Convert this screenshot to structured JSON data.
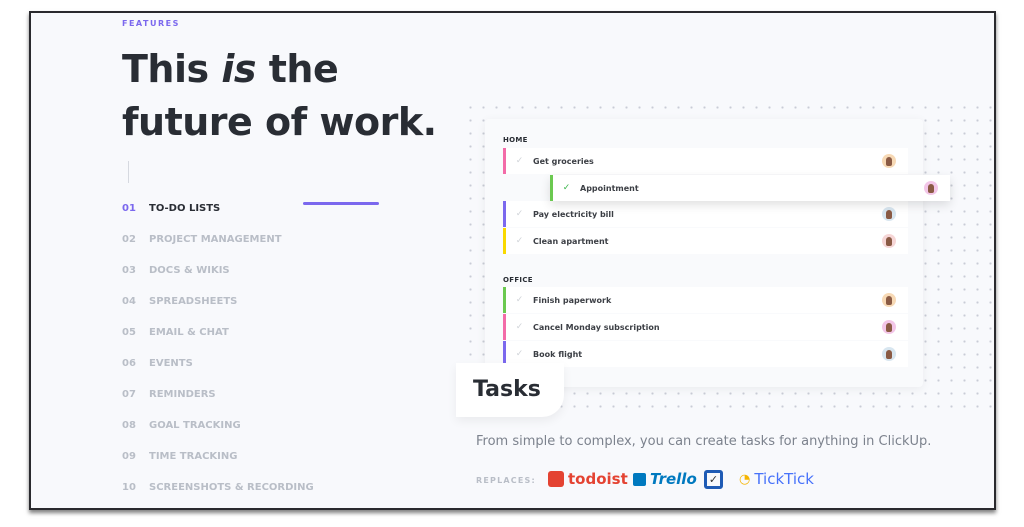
{
  "eyebrow": "FEATURES",
  "headline": {
    "line1_a": "This ",
    "line1_em": "is",
    "line1_b": " the",
    "line2": "future of work."
  },
  "nav": [
    {
      "num": "01",
      "label": "TO-DO LISTS",
      "active": true
    },
    {
      "num": "02",
      "label": "PROJECT MANAGEMENT"
    },
    {
      "num": "03",
      "label": "DOCS & WIKIS"
    },
    {
      "num": "04",
      "label": "SPREADSHEETS"
    },
    {
      "num": "05",
      "label": "EMAIL & CHAT"
    },
    {
      "num": "06",
      "label": "EVENTS"
    },
    {
      "num": "07",
      "label": "REMINDERS"
    },
    {
      "num": "08",
      "label": "GOAL TRACKING"
    },
    {
      "num": "09",
      "label": "TIME TRACKING"
    },
    {
      "num": "10",
      "label": "SCREENSHOTS & RECORDING"
    }
  ],
  "groups": {
    "home": {
      "label": "HOME",
      "tasks": [
        {
          "name": "Get groceries",
          "color": "#f36ba8"
        },
        {
          "name": "Appointment",
          "color": "#6bc950",
          "done": true
        },
        {
          "name": "Pay electricity bill",
          "color": "#7b68ee"
        },
        {
          "name": "Clean apartment",
          "color": "#f9d900"
        }
      ]
    },
    "office": {
      "label": "OFFICE",
      "tasks": [
        {
          "name": "Finish paperwork",
          "color": "#6bc950"
        },
        {
          "name": "Cancel Monday subscription",
          "color": "#f36ba8"
        },
        {
          "name": "Book flight",
          "color": "#7b68ee"
        }
      ]
    }
  },
  "tab_label": "Tasks",
  "description": "From simple to complex, you can create tasks for anything in ClickUp.",
  "replaces": {
    "label": "REPLACES:",
    "logos": [
      "todoist",
      "Trello",
      "TickTick"
    ]
  },
  "colors": {
    "accent": "#7b68ee",
    "todoist": "#e44332",
    "trello": "#0079bf",
    "ticktick": "#4772fa"
  }
}
